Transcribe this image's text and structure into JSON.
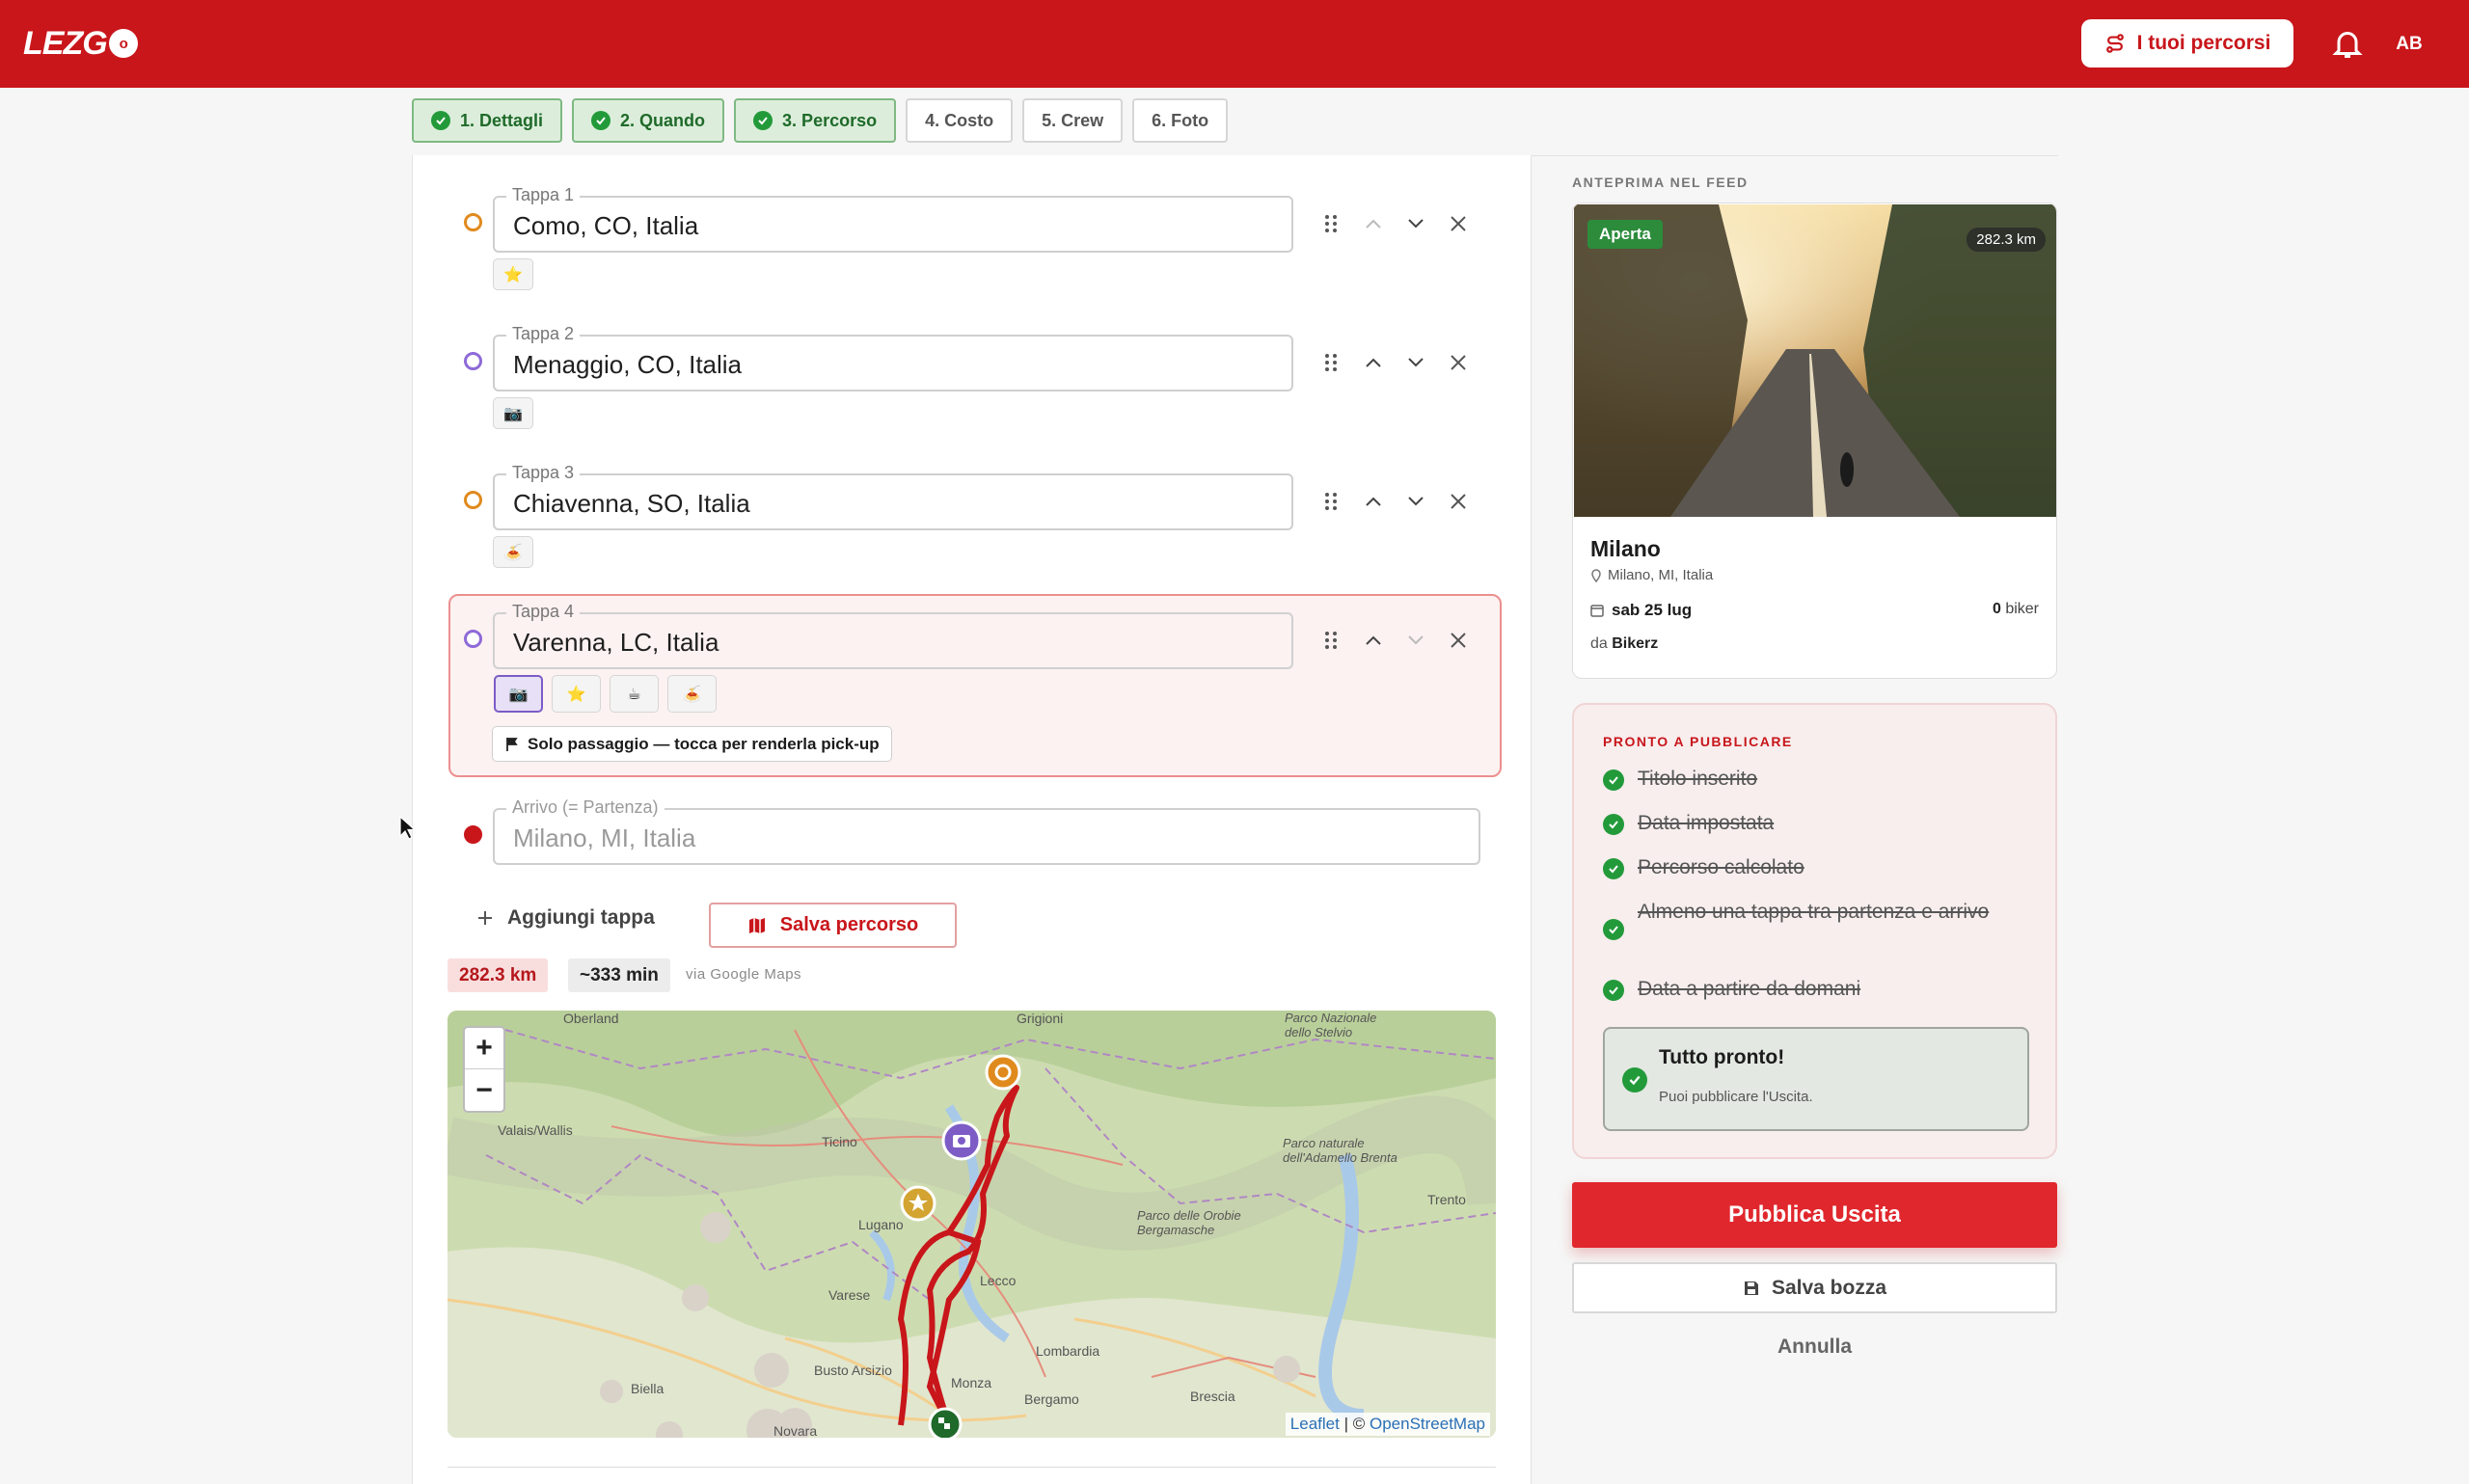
{
  "header": {
    "logo_text": "LEZG",
    "logo_badge": "o",
    "routes_button": "I tuoi percorsi",
    "avatar_initials": "AB",
    "brand_color": "#c8161b"
  },
  "steps": [
    {
      "label": "1. Dettagli",
      "done": true
    },
    {
      "label": "2. Quando",
      "done": true
    },
    {
      "label": "3. Percorso",
      "done": true
    },
    {
      "label": "4. Costo",
      "done": false
    },
    {
      "label": "5. Crew",
      "done": false
    },
    {
      "label": "6. Foto",
      "done": false
    }
  ],
  "stops": [
    {
      "label": "Tappa 1",
      "value": "Como, CO, Italia",
      "dot": "orange",
      "tag": "⭐"
    },
    {
      "label": "Tappa 2",
      "value": "Menaggio, CO, Italia",
      "dot": "purple",
      "tag": "📷"
    },
    {
      "label": "Tappa 3",
      "value": "Chiavenna, SO, Italia",
      "dot": "orange",
      "tag": "🍝"
    },
    {
      "label": "Tappa 4",
      "value": "Varenna, LC, Italia",
      "dot": "purple",
      "tags": [
        "📷",
        "⭐",
        "☕",
        "🍝"
      ],
      "pass_note": "Solo passaggio — tocca per renderla pick-up"
    }
  ],
  "arrival": {
    "label": "Arrivo (= Partenza)",
    "value": "Milano, MI, Italia"
  },
  "actions": {
    "add_stop": "Aggiungi tappa",
    "save_route": "Salva percorso"
  },
  "route_stats": {
    "distance": "282.3 km",
    "duration": "~333 min",
    "source": "via Google Maps"
  },
  "map": {
    "zoom_in": "+",
    "zoom_out": "−",
    "attribution_leaflet": "Leaflet",
    "attribution_sep": "| ©",
    "attribution_osm": "OpenStreetMap",
    "places": [
      "Oberland",
      "Grigioni",
      "Ticino",
      "Valais/Wallis",
      "Lugano",
      "Varese",
      "Lecco",
      "Busto Arsizio",
      "Monza",
      "Lombardia",
      "Bergamo",
      "Brescia",
      "Novara",
      "Biella",
      "Trento",
      "Parco delle Orobie Bergamasche",
      "Parco Nazionale dello Stelvio",
      "Parco naturale dell'Adamello Brenta"
    ]
  },
  "preview": {
    "section_label": "ANTEPRIMA NEL FEED",
    "status": "Aperta",
    "distance": "282.3 km",
    "title": "Milano",
    "location": "Milano, MI, Italia",
    "date": "sab 25 lug",
    "bikers": "0",
    "bikers_label": "biker",
    "by_label": "da",
    "by_name": "Bikerz"
  },
  "checklist": {
    "title": "PRONTO A PUBBLICARE",
    "items": [
      "Titolo inserito",
      "Data impostata",
      "Percorso calcolato",
      "Almeno una tappa tra partenza e arrivo",
      "Data a partire da domani"
    ],
    "done_title": "Tutto pronto!",
    "done_sub": "Puoi pubblicare l'Uscita."
  },
  "footer_actions": {
    "publish": "Pubblica Uscita",
    "draft": "Salva bozza",
    "cancel": "Annulla"
  }
}
